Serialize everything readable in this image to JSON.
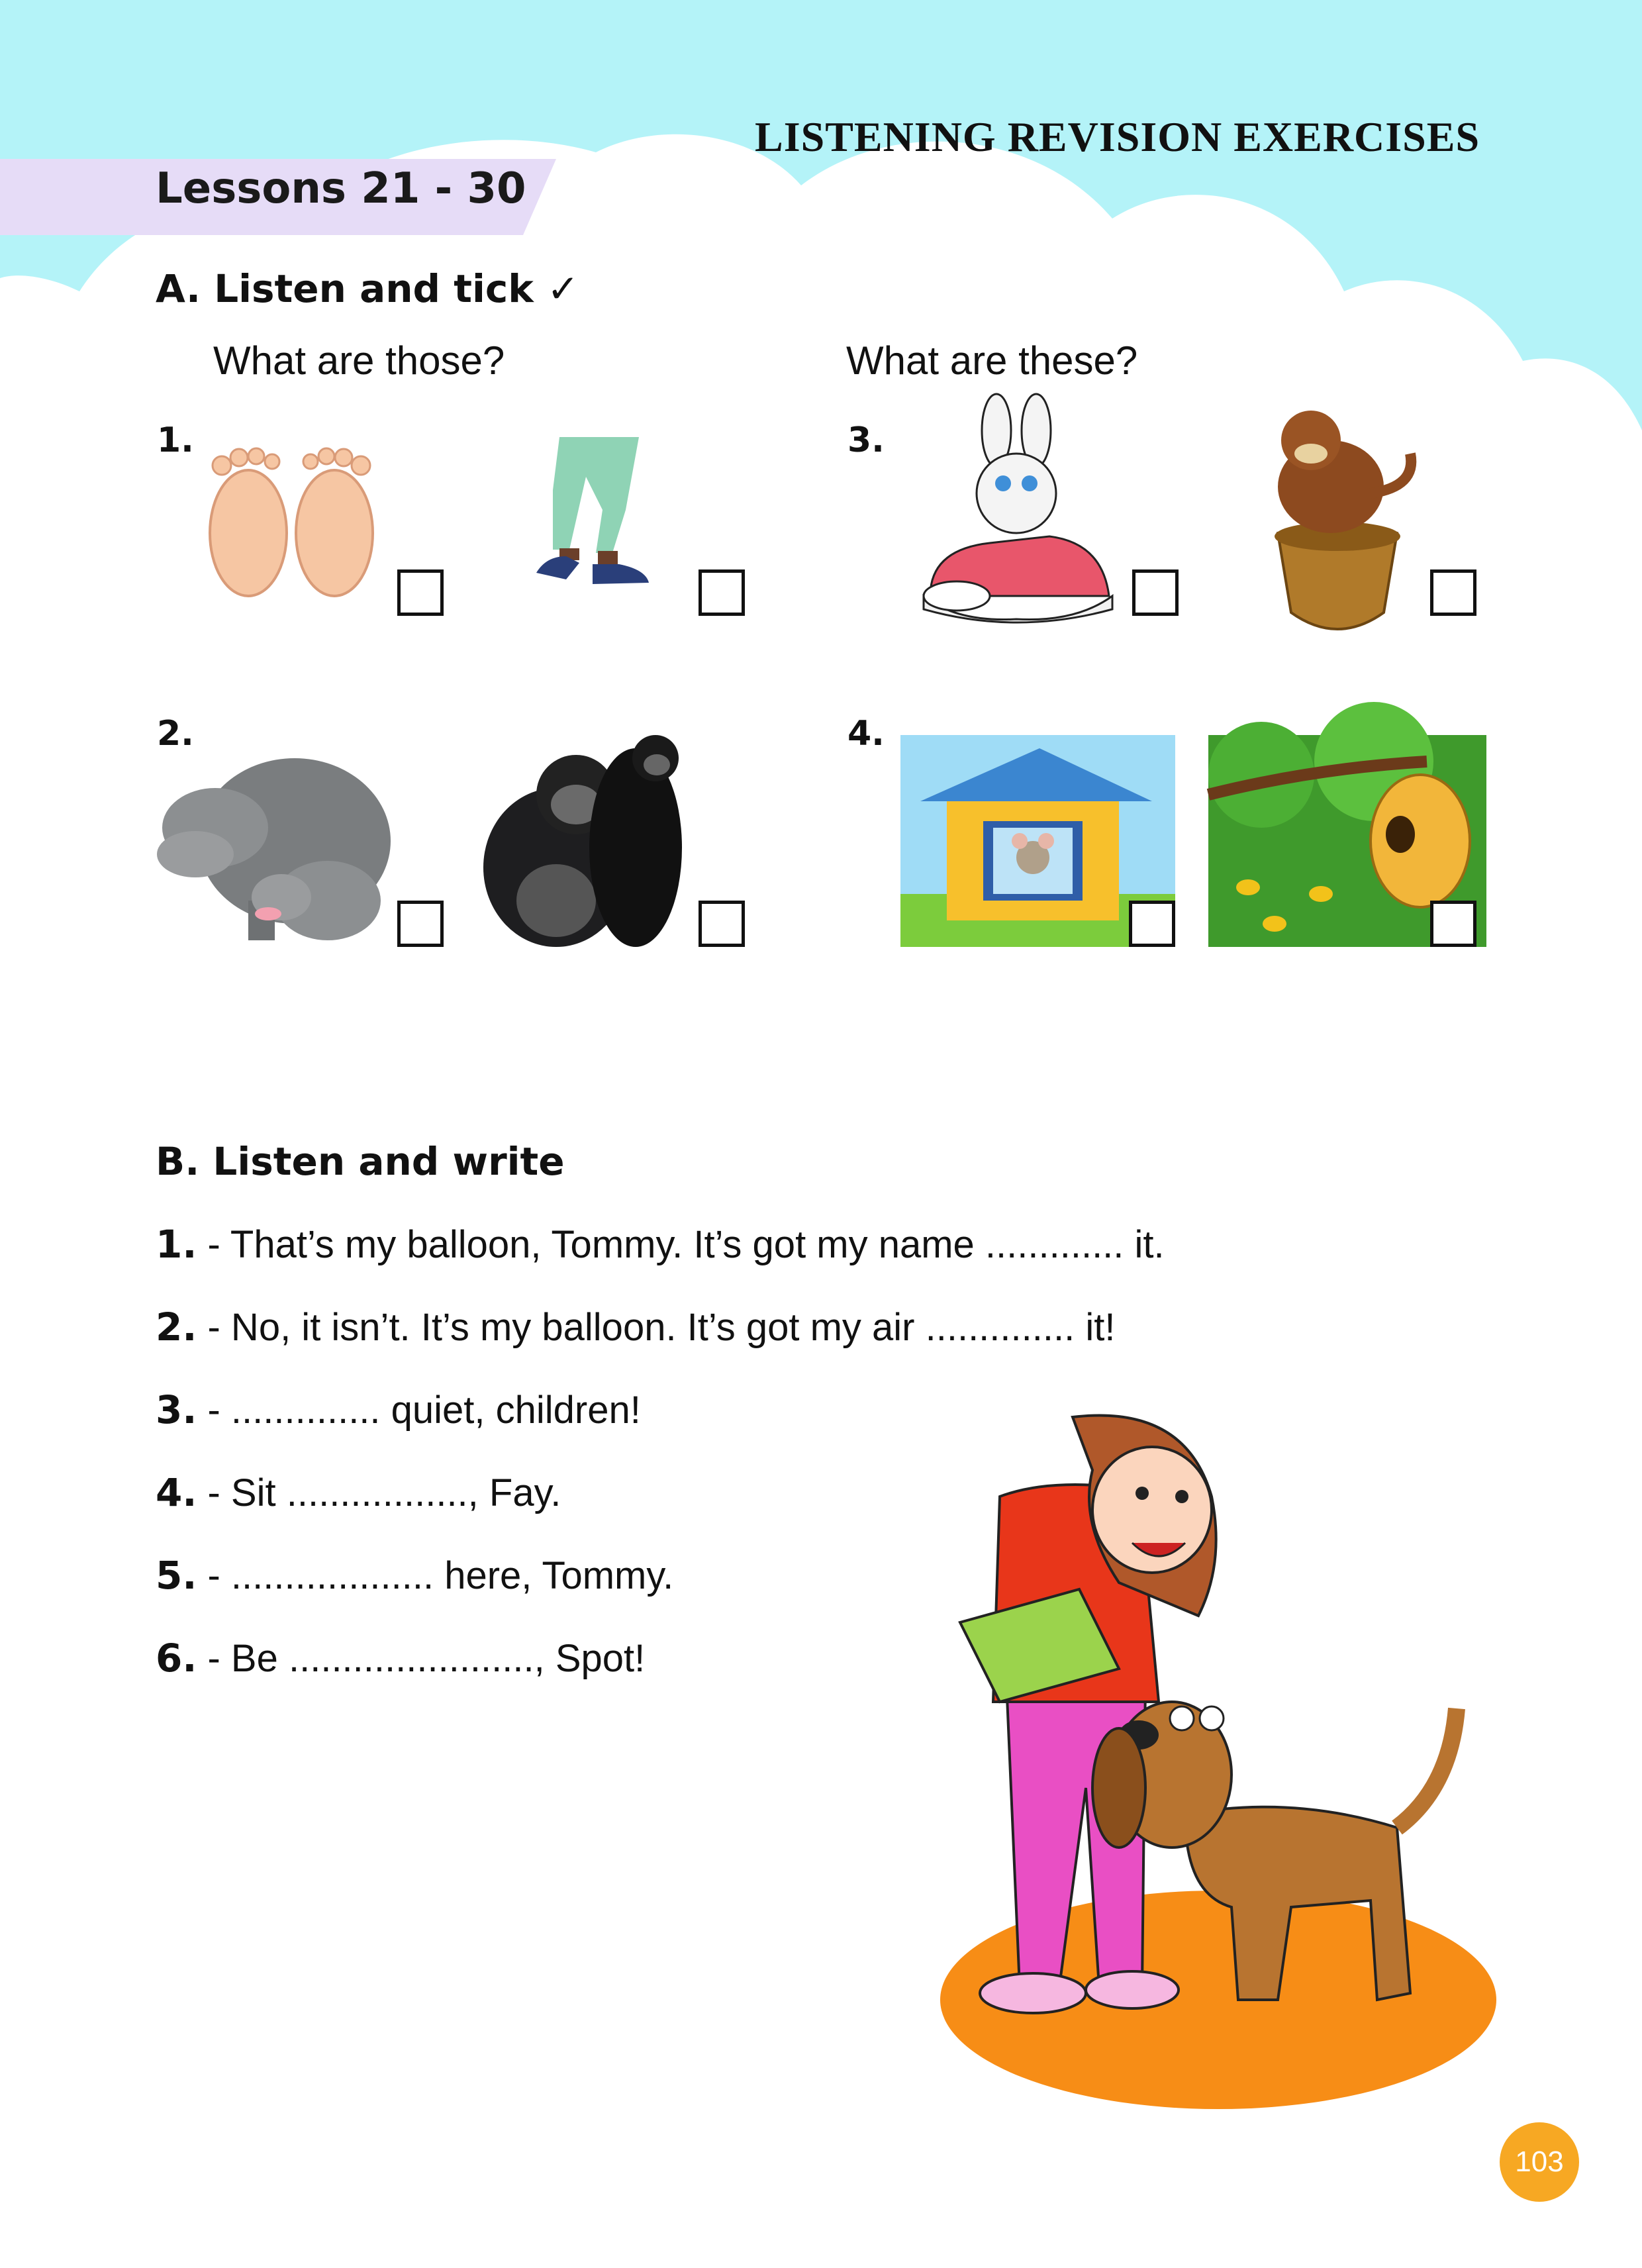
{
  "header": {
    "title": "LISTENING REVISION EXERCISES"
  },
  "lessons": {
    "label": "Lessons 21 - 30"
  },
  "section_a": {
    "title": "A. Listen and tick",
    "tick_symbol": "✓",
    "left_question": "What are those?",
    "right_question": "What are these?",
    "items": [
      {
        "number": "1.",
        "pictures": [
          "feet",
          "legs"
        ]
      },
      {
        "number": "2.",
        "pictures": [
          "hippos",
          "gorillas"
        ]
      },
      {
        "number": "3.",
        "pictures": [
          "rabbit-in-shoe",
          "beaver-on-acorn"
        ]
      },
      {
        "number": "4.",
        "pictures": [
          "mouse-house",
          "beehive"
        ]
      }
    ]
  },
  "section_b": {
    "title": "B. Listen and write",
    "sentences": [
      {
        "number": "1.",
        "text": " - That’s my balloon, Tommy. It’s got my name ............. it."
      },
      {
        "number": "2.",
        "text": " - No, it isn’t. It’s my balloon. It’s got my air .............. it!"
      },
      {
        "number": "3.",
        "text": " - .............. quiet, children!"
      },
      {
        "number": "4.",
        "text": " - Sit ................., Fay."
      },
      {
        "number": "5.",
        "text": " - ................... here, Tommy."
      },
      {
        "number": "6.",
        "text": " - Be ......................., Spot!"
      }
    ]
  },
  "page": {
    "number": "103"
  },
  "colors": {
    "sky": "#b4f3f8",
    "ribbon": "#e6dcf7",
    "page_badge": "#f7a823",
    "ground": "#f78d16"
  }
}
